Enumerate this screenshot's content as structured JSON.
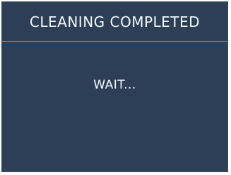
{
  "header": {
    "title": "CLEANING COMPLETED"
  },
  "body": {
    "message": "WAIT..."
  },
  "colors": {
    "panel_background": "#2c3f56",
    "header_separator": "#4a87c2",
    "text": "#f4f7fb"
  }
}
